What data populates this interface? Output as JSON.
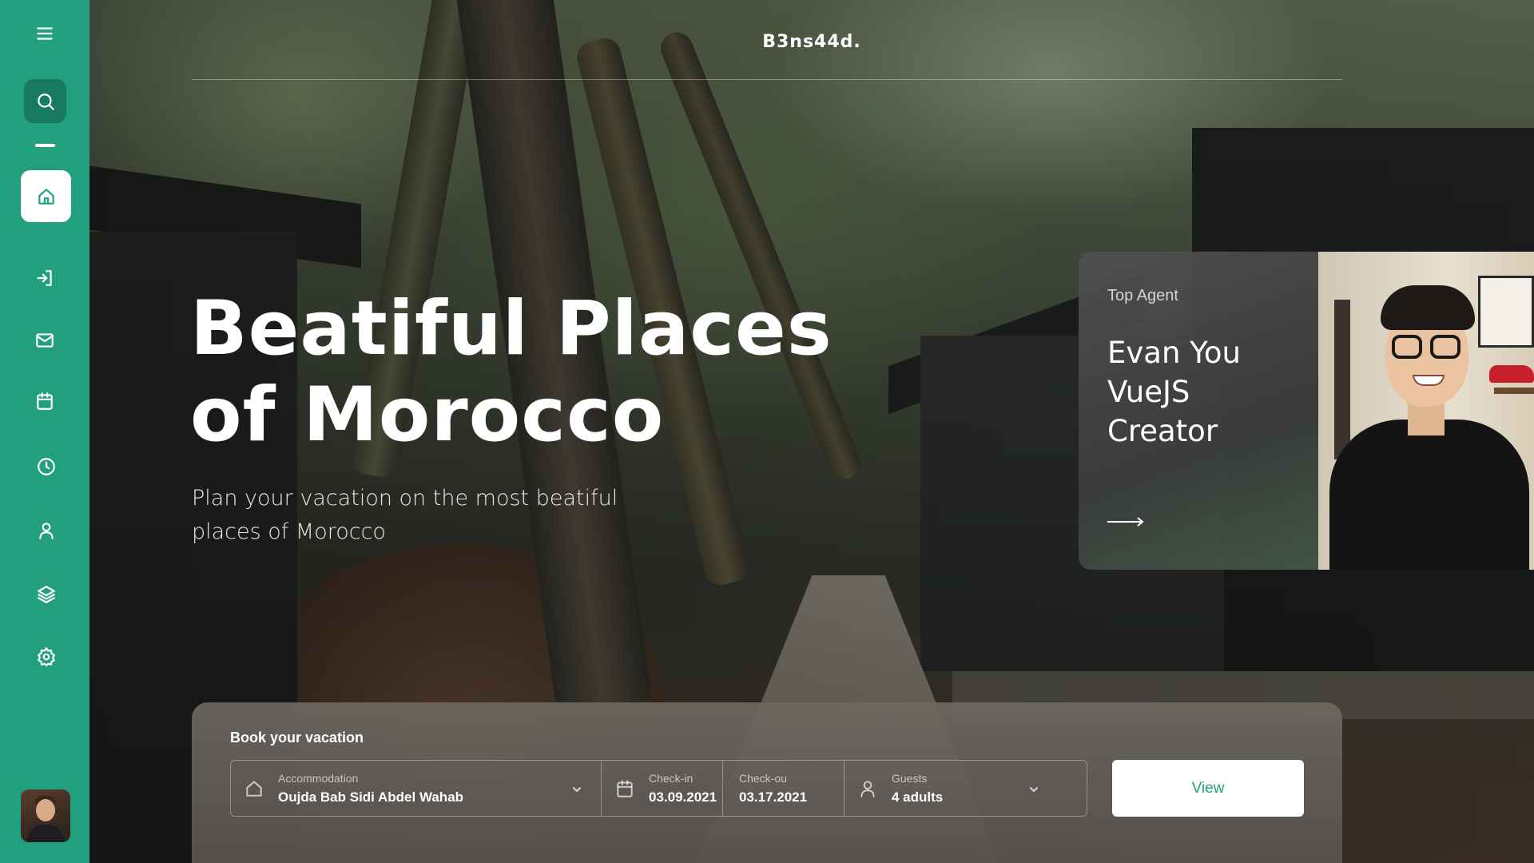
{
  "brand": {
    "name": "B3ns44d."
  },
  "hero": {
    "title_line1": "Beatiful Places",
    "title_line2": "of Morocco",
    "subtitle": "Plan your vacation on the most beatiful places of Morocco"
  },
  "sidebar": {
    "accent_color": "#22a07e",
    "items": [
      {
        "name": "menu",
        "icon": "hamburger-menu-icon"
      },
      {
        "name": "search",
        "icon": "search-icon"
      },
      {
        "name": "home",
        "icon": "home-icon",
        "active": true
      },
      {
        "name": "login",
        "icon": "login-icon"
      },
      {
        "name": "mail",
        "icon": "mail-icon"
      },
      {
        "name": "calendar",
        "icon": "calendar-icon"
      },
      {
        "name": "history",
        "icon": "clock-icon"
      },
      {
        "name": "profile",
        "icon": "user-icon"
      },
      {
        "name": "layers",
        "icon": "layers-icon"
      },
      {
        "name": "settings",
        "icon": "gear-icon"
      }
    ]
  },
  "agent": {
    "label": "Top Agent",
    "name_line1": "Evan You",
    "name_line2": "VueJS",
    "name_line3": "Creator"
  },
  "booking": {
    "title": "Book your vacation",
    "accommodation": {
      "label": "Accommodation",
      "value": "Oujda Bab Sidi Abdel Wahab"
    },
    "checkin": {
      "label": "Check-in",
      "value": "03.09.2021"
    },
    "checkout": {
      "label": "Check-ou",
      "value": "03.17.2021"
    },
    "guests": {
      "label": "Guests",
      "value": "4 adults"
    },
    "button_label": "View"
  }
}
